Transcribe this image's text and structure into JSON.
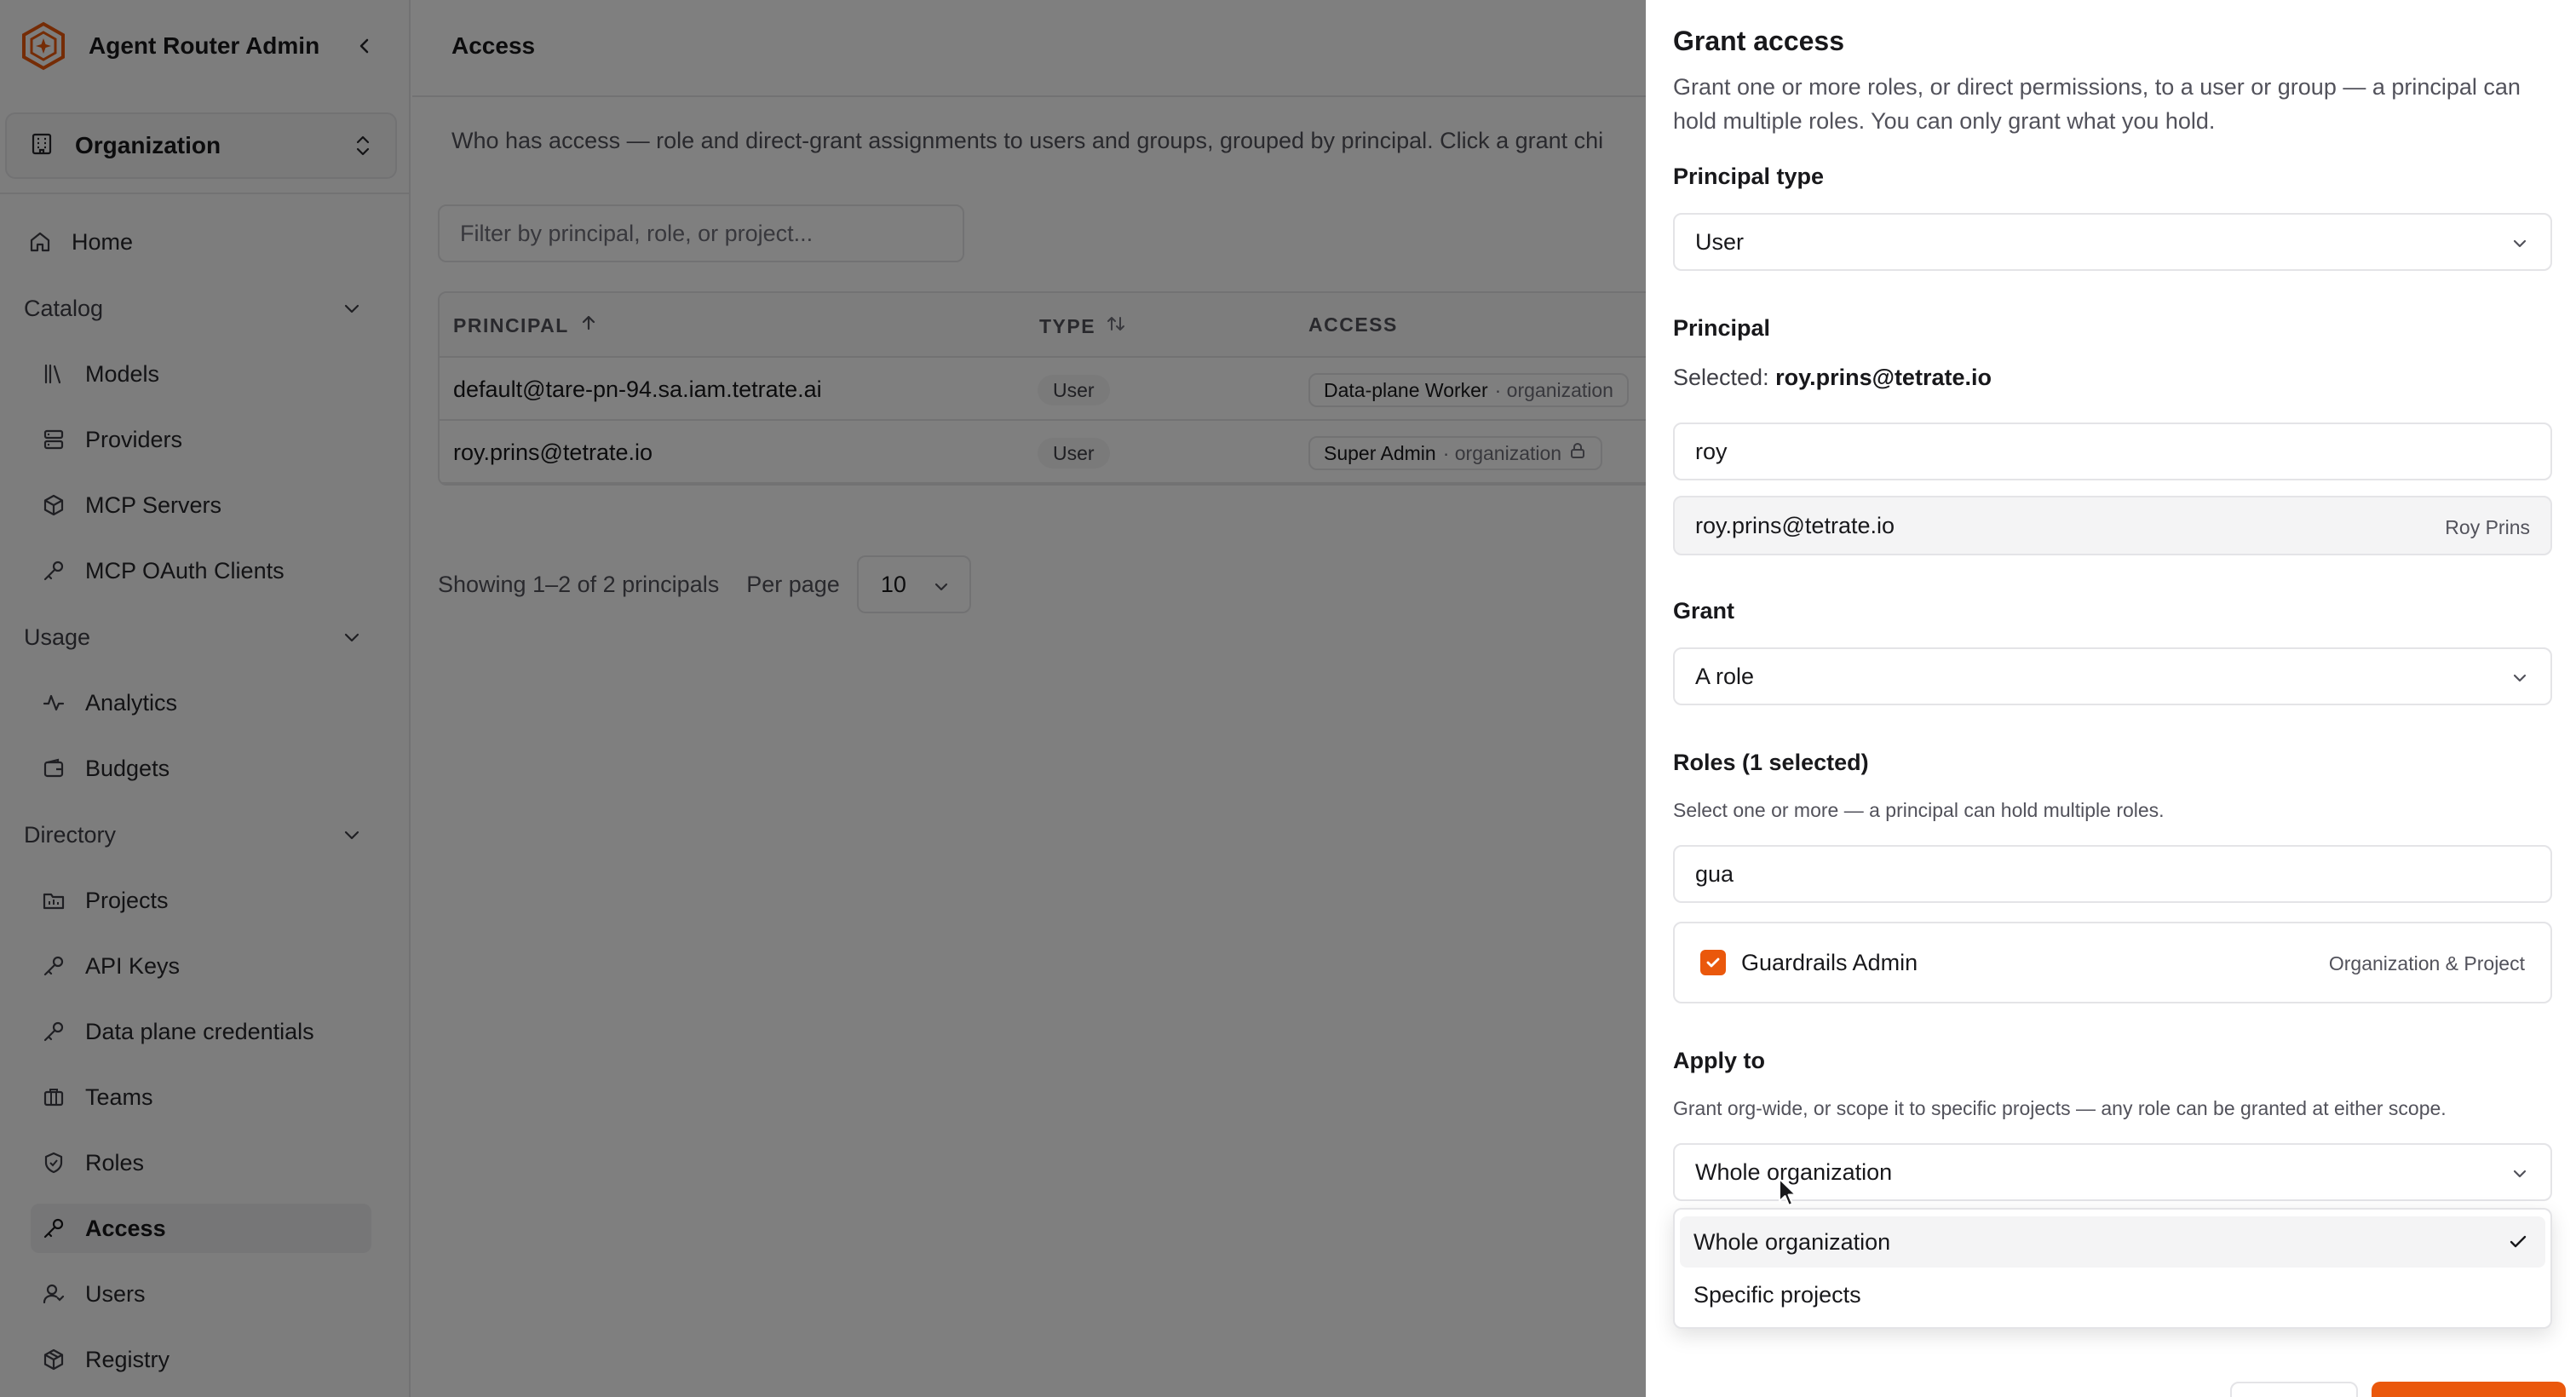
{
  "app": {
    "title": "Agent Router Admin"
  },
  "org_switcher": {
    "label": "Organization"
  },
  "nav": {
    "home": "Home",
    "catalog": {
      "label": "Catalog",
      "items": [
        "Models",
        "Providers",
        "MCP Servers",
        "MCP OAuth Clients"
      ]
    },
    "usage": {
      "label": "Usage",
      "items": [
        "Analytics",
        "Budgets"
      ]
    },
    "directory": {
      "label": "Directory",
      "items": [
        "Projects",
        "API Keys",
        "Data plane credentials",
        "Teams",
        "Roles",
        "Access",
        "Users",
        "Registry"
      ]
    },
    "active": "Access"
  },
  "main": {
    "title": "Access",
    "description": "Who has access — role and direct-grant assignments to users and groups, grouped by principal. Click a grant chi",
    "filter_placeholder": "Filter by principal, role, or project...",
    "columns": {
      "principal": "PRINCIPAL",
      "type": "TYPE",
      "access": "ACCESS"
    },
    "rows": [
      {
        "principal": "default@tare-pn-94.sa.iam.tetrate.ai",
        "type": "User",
        "grant": "Data-plane Worker",
        "scope": "· organization"
      },
      {
        "principal": "roy.prins@tetrate.io",
        "type": "User",
        "grant": "Super Admin",
        "scope": "· organization"
      }
    ],
    "pagination": {
      "showing": "Showing 1–2 of 2 principals",
      "per_page_label": "Per page",
      "per_page_value": "10"
    }
  },
  "drawer": {
    "title": "Grant access",
    "description": "Grant one or more roles, or direct permissions, to a user or group — a principal can hold multiple roles. You can only grant what you hold.",
    "principal_type": {
      "label": "Principal type",
      "value": "User"
    },
    "principal": {
      "label": "Principal",
      "selected_label": "Selected:",
      "selected_value": "roy.prins@tetrate.io",
      "search_value": "roy",
      "suggestion": {
        "email": "roy.prins@tetrate.io",
        "name": "Roy Prins"
      }
    },
    "grant": {
      "label": "Grant",
      "value": "A role"
    },
    "roles": {
      "label": "Roles (1 selected)",
      "help": "Select one or more — a principal can hold multiple roles.",
      "search_value": "gua",
      "items": [
        {
          "name": "Guardrails Admin",
          "scope": "Organization & Project",
          "checked": true
        }
      ]
    },
    "apply_to": {
      "label": "Apply to",
      "help": "Grant org-wide, or scope it to specific projects — any role can be granted at either scope.",
      "value": "Whole organization",
      "options": [
        "Whole organization",
        "Specific projects"
      ],
      "selected_index": 0
    }
  },
  "colors": {
    "accent": "#ea580c",
    "overlay": "rgba(0,0,0,0.5)",
    "border": "#e4e4e7",
    "muted_text": "#52525b"
  }
}
